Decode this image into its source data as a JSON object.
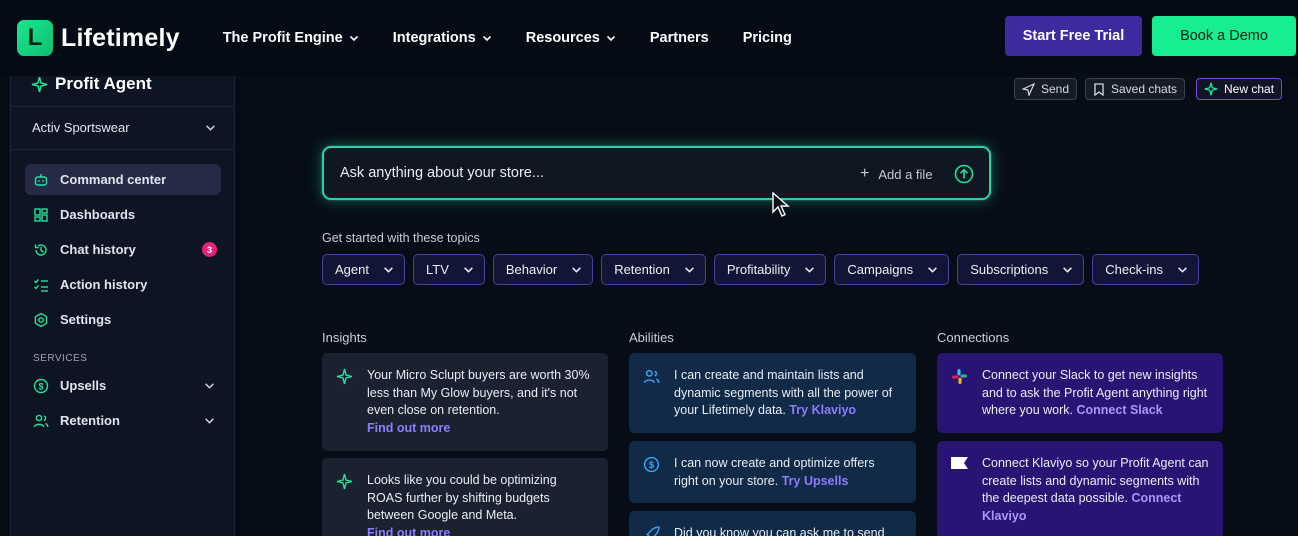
{
  "nav": {
    "logo_letter": "L",
    "logo_text": "Lifetimely",
    "links": [
      {
        "label": "The Profit Engine",
        "dropdown": true
      },
      {
        "label": "Integrations",
        "dropdown": true
      },
      {
        "label": "Resources",
        "dropdown": true
      },
      {
        "label": "Partners",
        "dropdown": false
      },
      {
        "label": "Pricing",
        "dropdown": false
      }
    ],
    "trial_label": "Start Free Trial",
    "demo_label": "Book a Demo"
  },
  "sidebar": {
    "title": "Profit Agent",
    "store": "Activ Sportswear",
    "items": [
      {
        "label": "Command center",
        "icon": "robot-icon",
        "active": true
      },
      {
        "label": "Dashboards",
        "icon": "dashboard-icon"
      },
      {
        "label": "Chat history",
        "icon": "history-icon",
        "badge": "3"
      },
      {
        "label": "Action history",
        "icon": "list-check-icon"
      },
      {
        "label": "Settings",
        "icon": "settings-icon"
      }
    ],
    "services_label": "SERVICES",
    "services": [
      {
        "label": "Upsells",
        "icon": "dollar-icon"
      },
      {
        "label": "Retention",
        "icon": "users-icon"
      }
    ]
  },
  "toolbar": {
    "send_label": "Send",
    "saved_label": "Saved chats",
    "new_label": "New chat"
  },
  "ask": {
    "placeholder": "Ask anything about your store...",
    "add_file": "Add a file"
  },
  "topics": {
    "label": "Get started with these topics",
    "items": [
      "Agent",
      "LTV",
      "Behavior",
      "Retention",
      "Profitability",
      "Campaigns",
      "Subscriptions",
      "Check-ins"
    ]
  },
  "insights": {
    "label": "Insights",
    "cards": [
      {
        "text": "Your Micro Sclupt buyers are worth 30% less than My Glow buyers, and it's not even close on retention.",
        "link": "Find out more"
      },
      {
        "text": "Looks like you could be optimizing ROAS further by shifting budgets between Google and Meta.",
        "link": "Find out more"
      }
    ]
  },
  "abilities": {
    "label": "Abilities",
    "cards": [
      {
        "text": "I can create and maintain lists and dynamic segments with all the power of your Lifetimely data.",
        "link": "Try Klaviyo"
      },
      {
        "text": "I can now create and optimize offers right on your store.",
        "link": "Try Upsells"
      },
      {
        "text": "Did you know you can ask me to send",
        "link": ""
      }
    ]
  },
  "connections": {
    "label": "Connections",
    "cards": [
      {
        "text": "Connect your Slack to get new insights and to ask the Profit Agent anything right where you work.",
        "link": "Connect Slack"
      },
      {
        "text": "Connect Klaviyo so your Profit Agent can create lists and dynamic segments with the deepest data possible.",
        "link": "Connect Klaviyo"
      }
    ]
  }
}
